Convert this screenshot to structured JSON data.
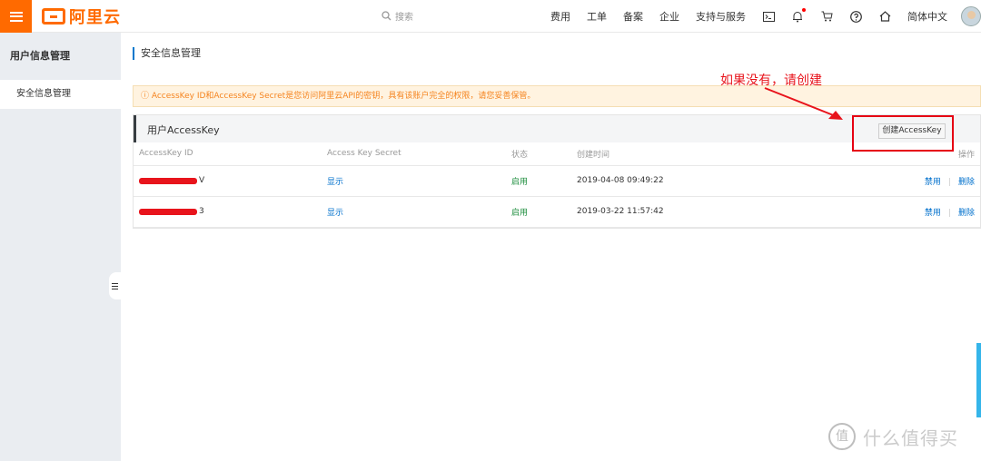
{
  "header": {
    "logo_text": "阿里云",
    "search_placeholder": "搜索",
    "nav_items": [
      "费用",
      "工单",
      "备案",
      "企业",
      "支持与服务"
    ],
    "language": "简体中文",
    "accent": "#ff6a00"
  },
  "sidebar": {
    "title": "用户信息管理",
    "items": [
      {
        "label": "安全信息管理",
        "active": true
      }
    ]
  },
  "main": {
    "page_title": "安全信息管理",
    "notice": "ⓘ AccessKey ID和AccessKey Secret是您访问阿里云API的密钥，具有该账户完全的权限，请您妥善保管。",
    "panel_title": "用户AccessKey",
    "create_button": "创建AccessKey",
    "columns": [
      "AccessKey ID",
      "Access Key Secret",
      "状态",
      "创建时间",
      "操作"
    ],
    "rows": [
      {
        "id_suffix": "V",
        "secret_action": "显示",
        "status": "启用",
        "created": "2019-04-08 09:49:22",
        "disable": "禁用",
        "delete": "删除"
      },
      {
        "id_suffix": "3",
        "secret_action": "显示",
        "status": "启用",
        "created": "2019-03-22 11:57:42",
        "disable": "禁用",
        "delete": "删除"
      }
    ]
  },
  "annotation": {
    "text": "如果没有，请创建",
    "color": "#e8141c"
  },
  "watermark": {
    "logo_char": "值",
    "text": "什么值得买"
  }
}
